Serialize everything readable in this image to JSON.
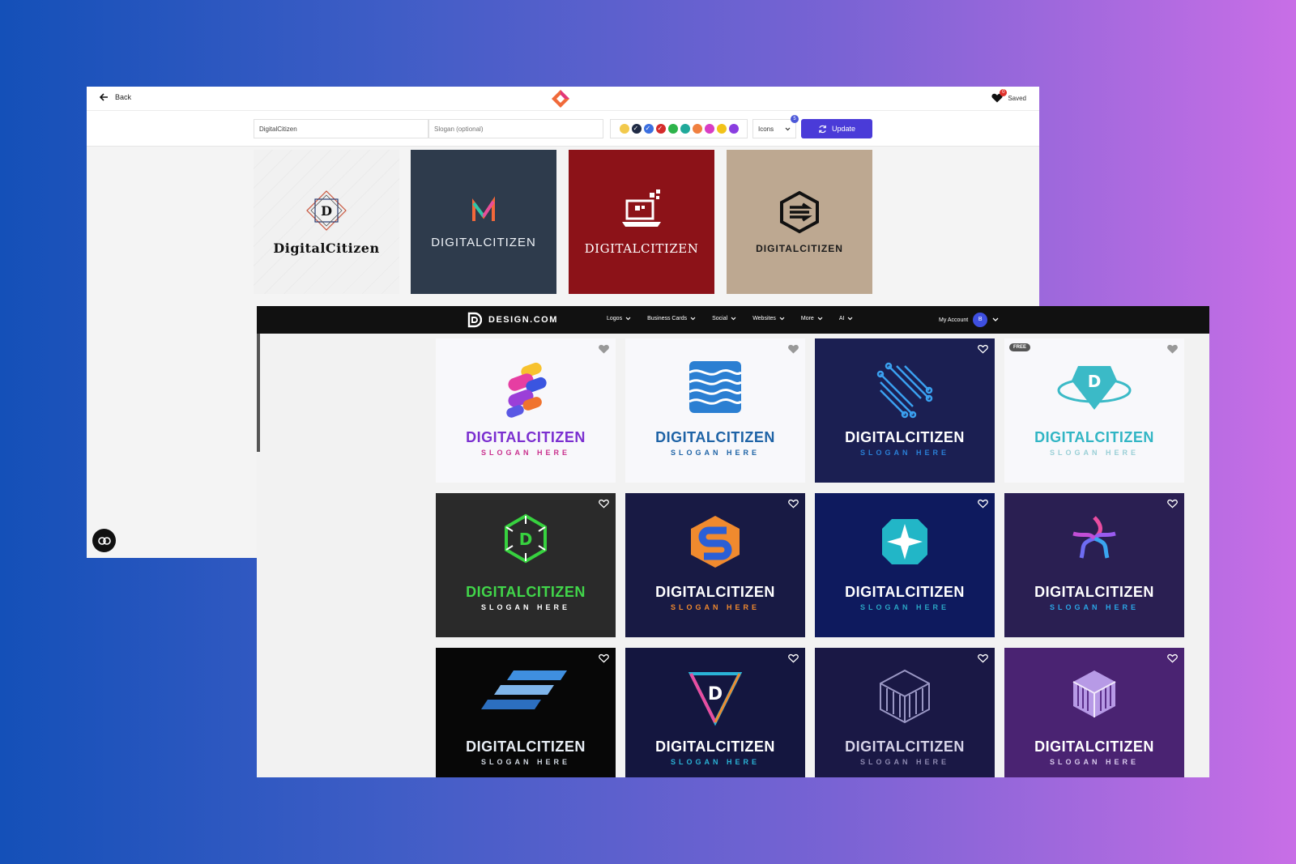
{
  "maker": {
    "back_label": "Back",
    "saved_label": "Saved",
    "saved_count": "0",
    "name_value": "DigitalCitizen",
    "slogan_placeholder": "Slogan (optional)",
    "icons_label": "Icons",
    "icons_count": "5",
    "update_label": "Update",
    "swatches": [
      "#f2c94c",
      "#1f2a44",
      "#3b6fe0",
      "#d42b2b",
      "#2db34a",
      "#20a99a",
      "#f08040",
      "#d83dc4",
      "#f2c31a",
      "#8a3ee0"
    ],
    "cards": [
      {
        "text": "DigitalCitizen",
        "bg": "#f0f0f0",
        "color": "#111",
        "icon": "diamond-monogram-icon"
      },
      {
        "text": "DIGITALCITIZEN",
        "bg": "#2e3b4c",
        "color": "#eef2f7",
        "icon": "zigzag-m-icon"
      },
      {
        "text": "DIGITALCITIZEN",
        "bg": "#8c1218",
        "color": "#ffffff",
        "icon": "laptop-icon"
      },
      {
        "text": "DIGITALCITIZEN",
        "bg": "#bda891",
        "color": "#1a1a1a",
        "icon": "hexagon-stripes-icon"
      }
    ]
  },
  "site": {
    "brand": "DESIGN.COM",
    "menu": [
      "Logos",
      "Business Cards",
      "Social",
      "Websites",
      "More",
      "AI"
    ],
    "account_label": "My Account",
    "avatar_initial": "B",
    "free_badge": "FREE",
    "tiles": [
      {
        "name": "DIGITALCITIZEN",
        "slogan": "SLOGAN HERE",
        "bg": "#f8f8fb",
        "name_color": "#7b2fd0",
        "slogan_color": "#c9308e",
        "icon": "colorful-pills-icon"
      },
      {
        "name": "DIGITALCITIZEN",
        "slogan": "SLOGAN HERE",
        "bg": "#f8f8fb",
        "name_color": "#1e63a6",
        "slogan_color": "#1e63a6",
        "icon": "wave-square-icon"
      },
      {
        "name": "DIGITALCITIZEN",
        "slogan": "SLOGAN HERE",
        "bg": "#1b1f52",
        "name_color": "#ffffff",
        "slogan_color": "#2a7fd6",
        "icon": "circuit-lines-icon"
      },
      {
        "name": "DIGITALCITIZEN",
        "slogan": "SLOGAN HERE",
        "bg": "#f8f8fb",
        "name_color": "#31b5c4",
        "slogan_color": "#9acfd6",
        "icon": "teal-badge-d-icon"
      },
      {
        "name": "DIGITALCITIZEN",
        "slogan": "SLOGAN HERE",
        "bg": "#2a2a2a",
        "name_color": "#41d64a",
        "slogan_color": "#ffffff",
        "icon": "green-gear-d-icon"
      },
      {
        "name": "DIGITALCITIZEN",
        "slogan": "SLOGAN HERE",
        "bg": "#181a44",
        "name_color": "#ffffff",
        "slogan_color": "#f0892e",
        "icon": "orange-blue-s-icon"
      },
      {
        "name": "DIGITALCITIZEN",
        "slogan": "SLOGAN HERE",
        "bg": "#0e1a5e",
        "name_color": "#ffffff",
        "slogan_color": "#2aa6c4",
        "icon": "teal-star-icon"
      },
      {
        "name": "DIGITALCITIZEN",
        "slogan": "SLOGAN HERE",
        "bg": "#2a1f52",
        "name_color": "#ffffff",
        "slogan_color": "#2aa6e6",
        "icon": "flower-knot-icon"
      },
      {
        "name": "DIGITALCITIZEN",
        "slogan": "SLOGAN HERE",
        "bg": "#070707",
        "name_color": "#e8eef5",
        "slogan_color": "#cfd6df",
        "icon": "speed-stripes-icon"
      },
      {
        "name": "DIGITALCITIZEN",
        "slogan": "SLOGAN HERE",
        "bg": "#14163f",
        "name_color": "#ffffff",
        "slogan_color": "#2ab3d6",
        "icon": "triangle-d-icon"
      },
      {
        "name": "DIGITALCITIZEN",
        "slogan": "SLOGAN HERE",
        "bg": "#1a1845",
        "name_color": "#d6d3e8",
        "slogan_color": "#8d89b0",
        "icon": "cube-icon"
      },
      {
        "name": "DIGITALCITIZEN",
        "slogan": "SLOGAN HERE",
        "bg": "#4a2372",
        "name_color": "#ffffff",
        "slogan_color": "#d8c9ec",
        "icon": "striped-cube-icon"
      }
    ]
  }
}
